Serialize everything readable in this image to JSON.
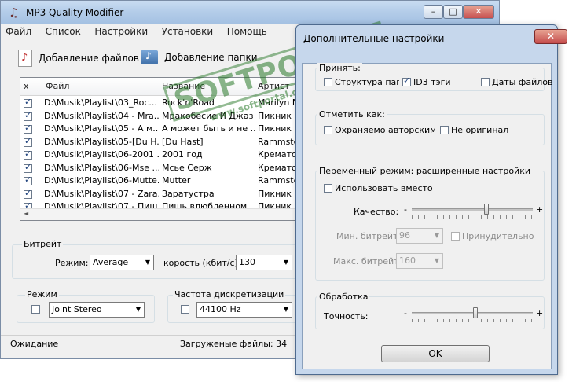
{
  "main": {
    "title": "MP3 Quality Modifier",
    "menu": [
      "Файл",
      "Список",
      "Настройки",
      "Установки",
      "Помощь"
    ],
    "toolbar": {
      "add_files": "Добавление файлов",
      "add_folder": "Добавление папки"
    },
    "columns": [
      "x",
      "Файл",
      "Название",
      "Артист"
    ],
    "rows": [
      {
        "file": "D:\\Musik\\Playlist\\03_Roc...",
        "title": "Rock'n'Road",
        "artist": "Marilyn Man"
      },
      {
        "file": "D:\\Musik\\Playlist\\04 - Mra...",
        "title": "Мракобесие И Джаз",
        "artist": "Пикник"
      },
      {
        "file": "D:\\Musik\\Playlist\\05 - А м...",
        "title": "А может быть и не ...",
        "artist": "Пикник"
      },
      {
        "file": "D:\\Musik\\Playlist\\05-[Du H...",
        "title": "[Du Hast]",
        "artist": "Rammstein"
      },
      {
        "file": "D:\\Musik\\Playlist\\06-2001 ...",
        "title": "2001 год",
        "artist": "Крематори"
      },
      {
        "file": "D:\\Musik\\Playlist\\06-Mse ...",
        "title": "Мсье Серж",
        "artist": "Крематори"
      },
      {
        "file": "D:\\Musik\\Playlist\\06-Mutte...",
        "title": "Mutter",
        "artist": "Rammstein"
      },
      {
        "file": "D:\\Musik\\Playlist\\07 - Zara...",
        "title": "Заратустра",
        "artist": "Пикник"
      },
      {
        "file": "D:\\Musik\\Playlist\\07 - Пиш...",
        "title": "Пишь влюбленном...",
        "artist": "Пикник"
      }
    ],
    "bitrate": {
      "title": "Битрейт",
      "mode_label": "Режим:",
      "mode_value": "Average",
      "speed_label": "корость (кбит/с):",
      "speed_value": "130"
    },
    "mode": {
      "title": "Режим",
      "value": "Joint Stereo"
    },
    "freq": {
      "title": "Частота дискретизации",
      "value": "44100 Hz"
    },
    "status": {
      "left": "Ожидание",
      "right": "Загруженые файлы: 34"
    }
  },
  "dialog": {
    "title": "Дополнительные настройки",
    "close": "✕",
    "accept": {
      "title": "Принять:",
      "structure": "Структура папо",
      "id3": "ID3 тэги",
      "dates": "Даты файлов"
    },
    "mark": {
      "title": "Отметить как:",
      "copyright": "Охраняемо авторским п",
      "not_original": "Не оригинал"
    },
    "vbr": {
      "title": "Переменный режим: расширенные настройки",
      "use_instead": "Использовать вместо",
      "quality": "Качество:",
      "min_label": "Мин. битрейт:",
      "min_value": "96",
      "forced": "Принудительно",
      "max_label": "Макс. битрейт:",
      "max_value": "160",
      "quality_level": 0.62
    },
    "processing": {
      "title": "Обработка",
      "accuracy": "Точность:",
      "accuracy_level": 0.53
    },
    "minus": "-",
    "plus": "+",
    "ok": "OK"
  },
  "watermark": {
    "brand": "SOFTPORTAL",
    "url": "www.softportal.com",
    "tm": "TM"
  },
  "colors": {
    "titlebar": "#b4cde9",
    "dialog_frame": "#c6d7ec",
    "close_red": "#c75050"
  }
}
